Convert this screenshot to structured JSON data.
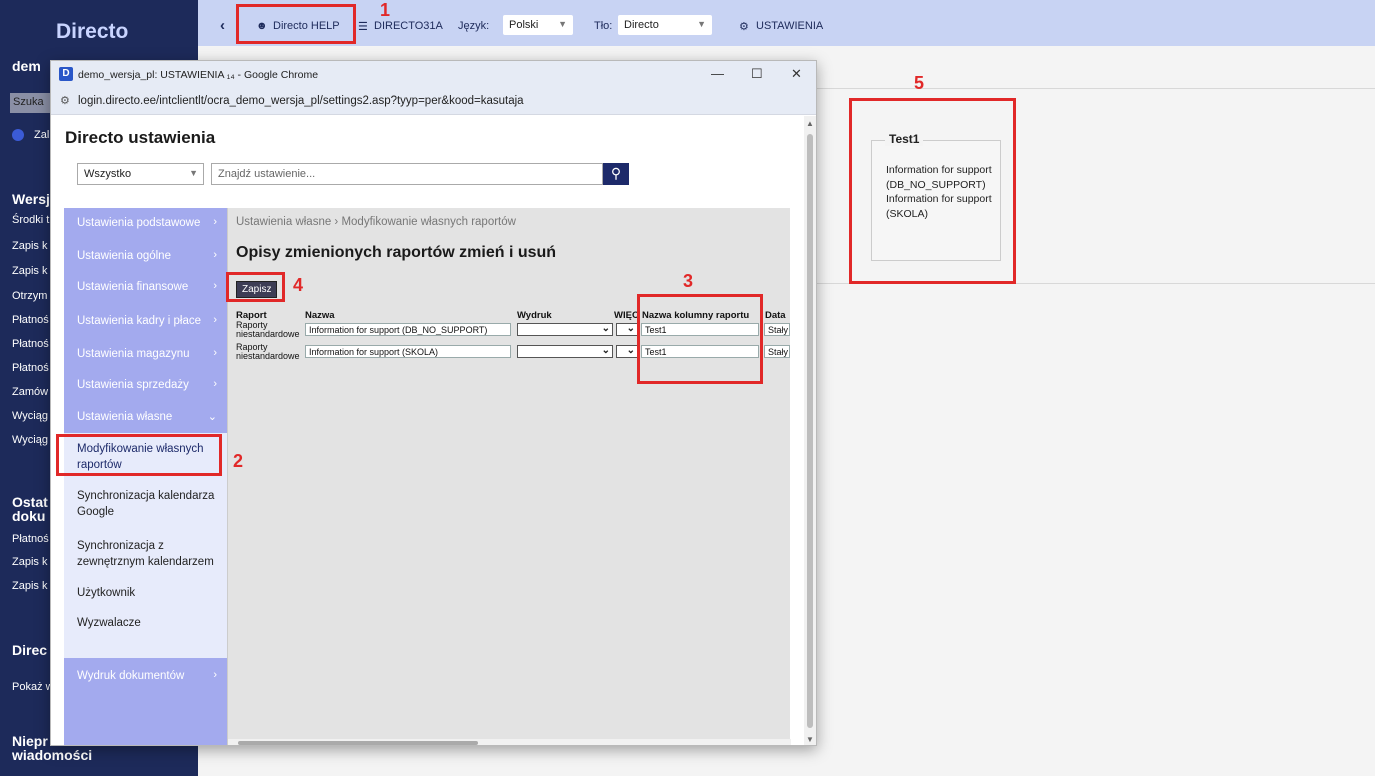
{
  "app": {
    "logo": "Directo",
    "side_search": "Szuka",
    "company_short": "dem",
    "side_link": "Zal",
    "section_wersj": "Wersj",
    "side_items": [
      "Środki t",
      "Zapis k",
      "Zapis k",
      "Otrzym",
      "Płatnoś",
      "Płatnoś",
      "Płatnoś",
      "Zamów",
      "Wyciąg",
      "Wyciąg"
    ],
    "section_ostat": "Ostat",
    "section_doku": "doku",
    "side_items2": [
      "Płatnoś",
      "Zapis k",
      "Zapis k"
    ],
    "section_direc": "Direc",
    "side_pokaz": "Pokaż w",
    "section_niepr": "Niepr",
    "section_wiadomosci": "wiadomości"
  },
  "topbar": {
    "user": "Directo HELP",
    "db": "DIRECTO31A",
    "lang_label": "Język:",
    "lang_value": "Polski",
    "bg_label": "Tło:",
    "bg_value": "Directo",
    "settings": "USTAWIENIA"
  },
  "info_panel": {
    "title": "Test1",
    "text": "Information for support (DB_NO_SUPPORT) Information for support (SKOLA)"
  },
  "window": {
    "title": "demo_wersja_pl: USTAWIENIA ₁₄ - Google Chrome",
    "url": "login.directo.ee/intclientlt/ocra_demo_wersja_pl/settings2.asp?tyyp=per&kood=kasutaja",
    "minimize": "—",
    "maximize": "☐",
    "close": "✕"
  },
  "settings": {
    "title": "Directo ustawienia",
    "filter_value": "Wszystko",
    "search_placeholder": "Znajdź ustawienie...",
    "menu": [
      "Ustawienia podstawowe",
      "Ustawienia ogólne",
      "Ustawienia finansowe",
      "Ustawienia kadry i płace",
      "Ustawienia magazynu",
      "Ustawienia sprzedaży",
      "Ustawienia własne"
    ],
    "submenu": [
      "Modyfikowanie własnych raportów",
      "Synchronizacja kalendarza Google",
      "Synchronizacja z zewnętrznym kalendarzem",
      "Użytkownik",
      "Wyzwalacze"
    ],
    "menu_last": "Wydruk dokumentów",
    "breadcrumb": "Ustawienia własne › Modyfikowanie własnych raportów",
    "main_title": "Opisy zmienionych raportów zmień i usuń",
    "save_label": "Zapisz",
    "table": {
      "headers": [
        "Raport",
        "Nazwa",
        "Wydruk",
        "WIĘC",
        "Nazwa kolumny raportu",
        "Data"
      ],
      "rows": [
        {
          "raport1": "Raporty",
          "raport2": "niestandardowe",
          "nazwa": "Information for support (DB_NO_SUPPORT)",
          "kolumna": "Test1",
          "data": "Stały"
        },
        {
          "raport1": "Raporty",
          "raport2": "niestandardowe",
          "nazwa": "Information for support (SKOLA)",
          "kolumna": "Test1",
          "data": "Stały"
        }
      ]
    }
  },
  "annotations": {
    "n1": "1",
    "n2": "2",
    "n3": "3",
    "n4": "4",
    "n5": "5",
    "color": "#e12828"
  }
}
